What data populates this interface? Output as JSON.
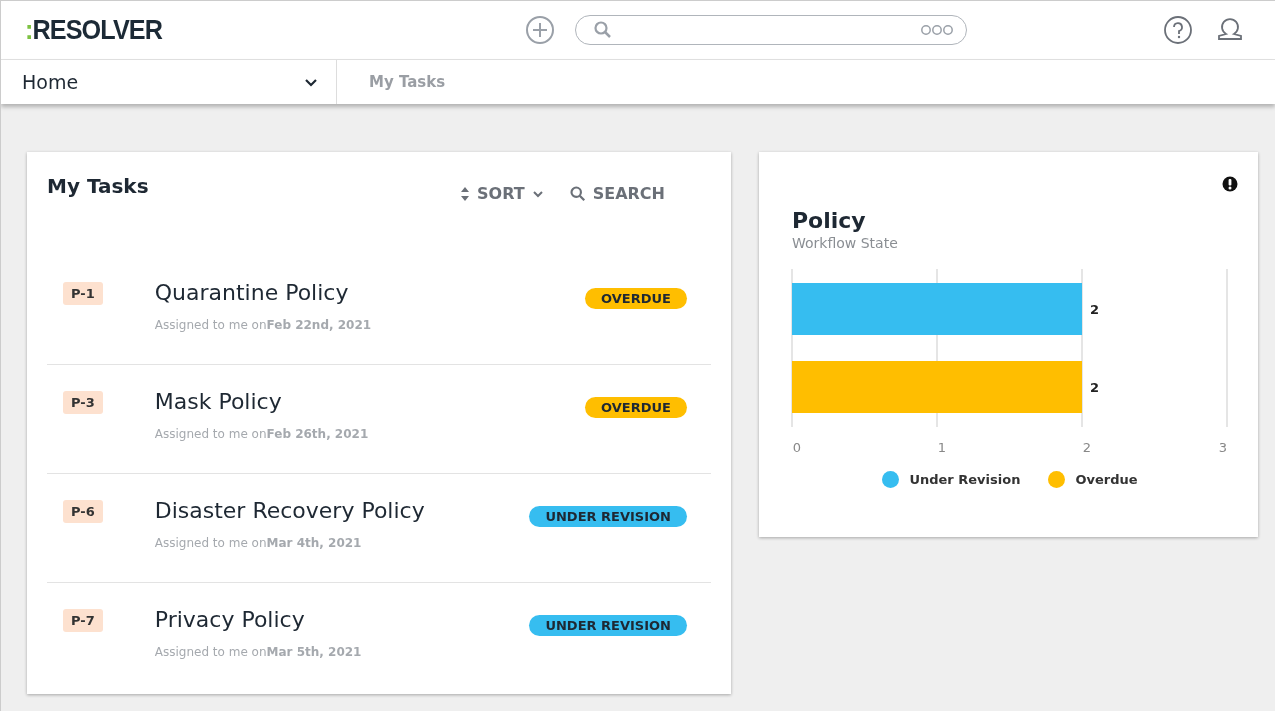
{
  "header": {
    "logo": {
      "mark": ":",
      "name": "RESOLVER"
    }
  },
  "nav": {
    "current": "Home",
    "breadcrumb": "My Tasks"
  },
  "tasks_card": {
    "title": "My Tasks",
    "sort": "SORT",
    "search": "SEARCH",
    "tasks": [
      {
        "id": "P-1",
        "title": "Quarantine Policy",
        "assigned": "Assigned to me on**Feb 22nd, 2021**",
        "status": "OVERDUE",
        "color": "#ffbe00"
      },
      {
        "id": "P-3",
        "title": "Mask Policy",
        "assigned": "Assigned to me on**Feb 26th, 2021**",
        "status": "OVERDUE",
        "color": "#ffbe00"
      },
      {
        "id": "P-6",
        "title": "Disaster Recovery Policy",
        "assigned": "Assigned to me on**Mar 4th, 2021**",
        "status": "UNDER REVISION",
        "color": "#36bdf0"
      },
      {
        "id": "P-7",
        "title": "Privacy Policy",
        "assigned": "Assigned to me on**Mar 5th, 2021**",
        "status": "UNDER REVISION",
        "color": "#36bdf0"
      }
    ]
  },
  "chart_card": {
    "title": "Policy",
    "subtitle": "Workflow State",
    "chart_data": {
      "type": "bar",
      "orientation": "horizontal",
      "xlim": [
        0,
        3
      ],
      "xticks": [
        0,
        1,
        2,
        3
      ],
      "data_labels": true,
      "series": [
        {
          "name": "Under Revision",
          "color": "#36bdf0",
          "values": [
            2
          ]
        },
        {
          "name": "Overdue",
          "color": "#ffbe00",
          "values": [
            2
          ]
        }
      ]
    }
  }
}
